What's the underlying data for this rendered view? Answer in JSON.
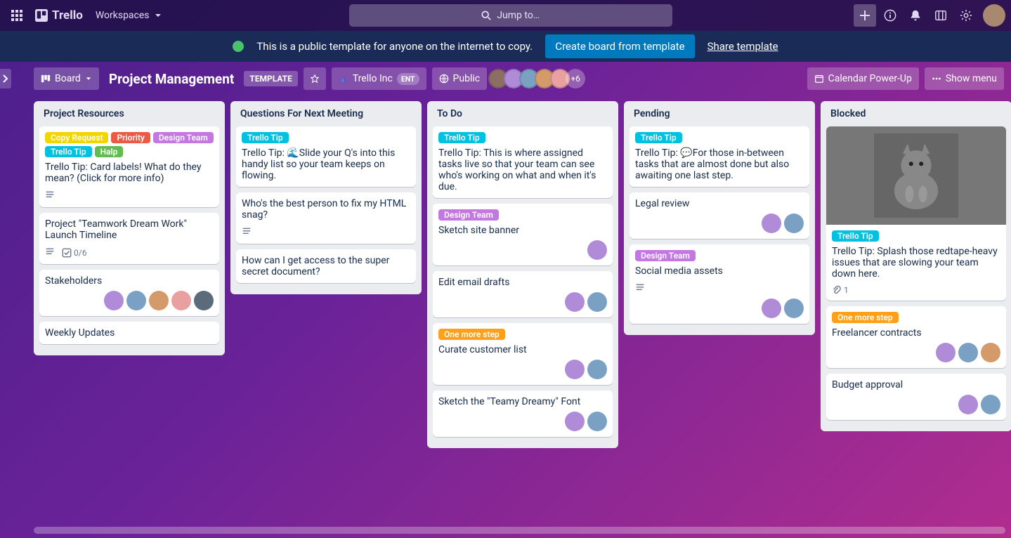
{
  "topbar": {
    "brand": "Trello",
    "workspaces": "Workspaces",
    "search_placeholder": "Jump to…"
  },
  "banner": {
    "message": "This is a public template for anyone on the internet to copy.",
    "create_label": "Create board from template",
    "share_label": "Share template"
  },
  "boardbar": {
    "view_label": "Board",
    "title": "Project Management",
    "template_badge": "TEMPLATE",
    "workspace_name": "Trello Inc",
    "workspace_plan": "ENT",
    "visibility": "Public",
    "overflow_members": "+6",
    "calendar_label": "Calendar Power-Up",
    "menu_label": "Show menu"
  },
  "label_text": {
    "copy_request": "Copy Request",
    "priority": "Priority",
    "design_team": "Design Team",
    "trello_tip": "Trello Tip",
    "halp": "Halp",
    "one_more_step": "One more step"
  },
  "lists": [
    {
      "title": "Project Resources",
      "cards": [
        {
          "labels": [
            "copy_request",
            "priority",
            "design_team",
            "trello_tip",
            "halp"
          ],
          "text": "Trello Tip: Card labels! What do they mean? (Click for more info)",
          "desc": true
        },
        {
          "text": "Project \"Teamwork Dream Work\" Launch Timeline",
          "desc": true,
          "checklist": "0/6"
        },
        {
          "text": "Stakeholders",
          "members": 5
        },
        {
          "text": "Weekly Updates"
        }
      ]
    },
    {
      "title": "Questions For Next Meeting",
      "cards": [
        {
          "labels": [
            "trello_tip"
          ],
          "text": "Trello Tip: 🌊Slide your Q's into this handy list so your team keeps on flowing."
        },
        {
          "text": "Who's the best person to fix my HTML snag?",
          "desc": true
        },
        {
          "text": "How can I get access to the super secret document?"
        }
      ]
    },
    {
      "title": "To Do",
      "cards": [
        {
          "labels": [
            "trello_tip"
          ],
          "text": "Trello Tip: This is where assigned tasks live so that your team can see who's working on what and when it's due."
        },
        {
          "labels": [
            "design_team"
          ],
          "text": "Sketch site banner",
          "members": 1
        },
        {
          "text": "Edit email drafts",
          "members": 2
        },
        {
          "labels": [
            "one_more_step"
          ],
          "text": "Curate customer list",
          "members": 2
        },
        {
          "text": "Sketch the \"Teamy Dreamy\" Font",
          "members": 2
        }
      ]
    },
    {
      "title": "Pending",
      "cards": [
        {
          "labels": [
            "trello_tip"
          ],
          "text": "Trello Tip: 💬For those in-between tasks that are almost done but also awaiting one last step."
        },
        {
          "text": "Legal review",
          "members": 2
        },
        {
          "labels": [
            "design_team"
          ],
          "text": "Social media assets",
          "desc": true,
          "members": 2
        }
      ]
    },
    {
      "title": "Blocked",
      "cards": [
        {
          "cover": true,
          "labels": [
            "trello_tip"
          ],
          "text": "Trello Tip: Splash those redtape-heavy issues that are slowing your team down here.",
          "attach": "1"
        },
        {
          "labels": [
            "one_more_step"
          ],
          "text": "Freelancer contracts",
          "members": 3
        },
        {
          "text": "Budget approval",
          "members": 2
        }
      ]
    }
  ],
  "label_class": {
    "copy_request": "l-yellow",
    "priority": "l-red",
    "design_team": "l-purple",
    "trello_tip": "l-teal",
    "halp": "l-green",
    "one_more_step": "l-orange"
  },
  "member_colors": [
    "#8d6e63",
    "#b08bd8",
    "#7aa1c4",
    "#d49a6a",
    "#e8a0a0",
    "#5c6b7a",
    "#9b7a4a"
  ]
}
